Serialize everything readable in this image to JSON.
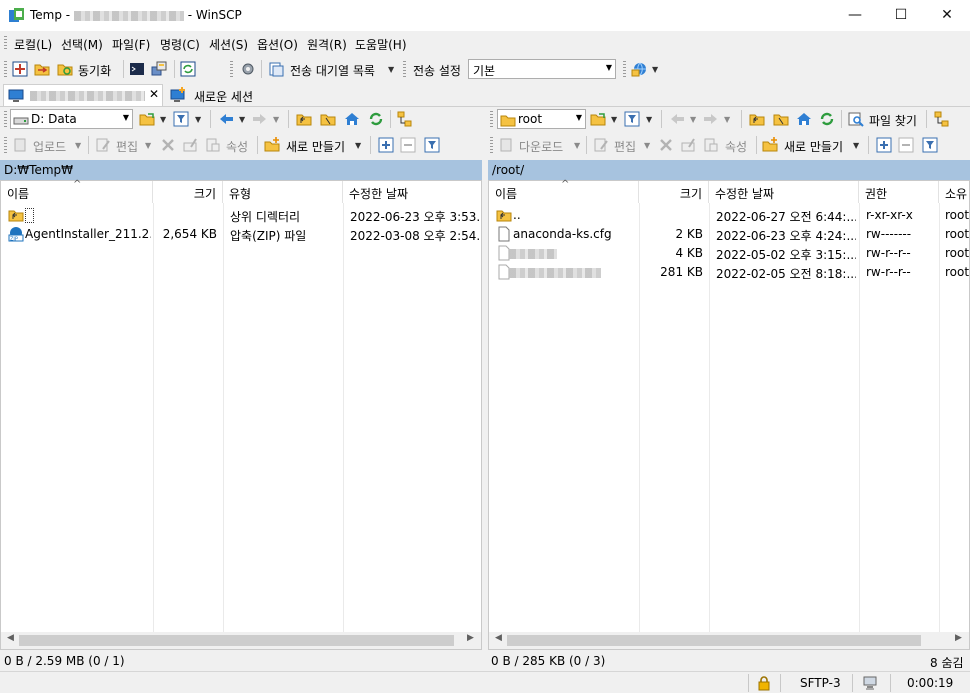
{
  "window": {
    "title_prefix": "Temp -",
    "title_suffix": "- WinSCP",
    "minimize": "—",
    "maximize": "☐",
    "close": "✕"
  },
  "menu": [
    {
      "label": "로컬(L)"
    },
    {
      "label": "선택(M)"
    },
    {
      "label": "파일(F)"
    },
    {
      "label": "명령(C)"
    },
    {
      "label": "세션(S)"
    },
    {
      "label": "옵션(O)"
    },
    {
      "label": "원격(R)"
    },
    {
      "label": "도움말(H)"
    }
  ],
  "toolbar": {
    "sync_label": "동기화",
    "queue_label": "전송 대기열 목록",
    "transfer_settings_label": "전송 설정",
    "transfer_preset": "기본"
  },
  "tabs": {
    "new_session_label": "새로운 세션"
  },
  "local": {
    "drive": "D: Data",
    "upload_label": "업로드",
    "edit_label": "편집",
    "properties_label": "속성",
    "new_label": "새로 만들기",
    "path": "D:₩Temp₩",
    "columns": [
      "이름",
      "크기",
      "유형",
      "수정한 날짜"
    ],
    "rows": [
      {
        "name": "",
        "size": "",
        "type": "상위 디렉터리",
        "modified": "2022-06-23  오후 3:53..."
      },
      {
        "name": "AgentInstaller_211.2...",
        "size": "2,654 KB",
        "type": "압축(ZIP) 파일",
        "modified": "2022-03-08  오후 2:54..."
      }
    ],
    "status": "0 B / 2.59 MB (0 / 1)"
  },
  "remote": {
    "folder": "root",
    "download_label": "다운로드",
    "edit_label": "편집",
    "properties_label": "속성",
    "new_label": "새로 만들기",
    "find_label": "파일 찾기",
    "path": "/root/",
    "columns": [
      "이름",
      "크기",
      "수정한 날짜",
      "권한",
      "소유"
    ],
    "rows": [
      {
        "name": "..",
        "size": "",
        "modified": "2022-06-27  오전 6:44:...",
        "rights": "r-xr-xr-x",
        "owner": "root"
      },
      {
        "name": "anaconda-ks.cfg",
        "size": "2 KB",
        "modified": "2022-06-23  오후 4:24:...",
        "rights": "rw-------",
        "owner": "root"
      },
      {
        "name": "",
        "size": "4 KB",
        "modified": "2022-05-02  오후 3:15:...",
        "rights": "rw-r--r--",
        "owner": "root"
      },
      {
        "name": "",
        "size": "281 KB",
        "modified": "2022-02-05  오전 8:18:...",
        "rights": "rw-r--r--",
        "owner": "root"
      }
    ],
    "status": "0 B / 285 KB (0 / 3)",
    "hidden": "8 숨김"
  },
  "statusbar": {
    "protocol": "SFTP-3",
    "elapsed": "0:00:19"
  },
  "colors": {
    "path_bar": "#a7c3df",
    "folder": "#f5c242",
    "accent_blue": "#1e73be",
    "green": "#2e9c3e"
  }
}
